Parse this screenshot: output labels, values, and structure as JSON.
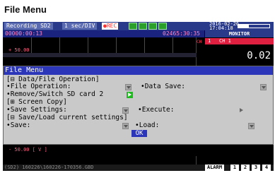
{
  "page_title": "File Menu",
  "topbar": {
    "mode": "Recording SD2",
    "speed": "1 sec/DIV",
    "rec": "●REC",
    "date": "2016-02-26",
    "time": "17:04:18",
    "battery_level": 0.35
  },
  "timebar": {
    "elapsed": "00000:00:13",
    "total": "02465:30:35"
  },
  "monitor": {
    "title": "MONITOR",
    "channel_num": "1",
    "channel_name": "CH 1",
    "value": "0.02",
    "ch_tag": "CH"
  },
  "graph": {
    "upper_value": "+ 50.00",
    "lower_value": "- 50.00 [ V ]"
  },
  "menu": {
    "title": "File Menu",
    "section_data_file": "[⊟ Data/File Operation]",
    "file_operation_label": "•File Operation:",
    "data_save_label": "•Data Save:",
    "remove_sd_label": "•Remove/Switch SD card 2",
    "section_screen_copy": "[⊞ Screen Copy]",
    "save_settings_label": "•Save Settings:",
    "execute_label": "•Execute:",
    "section_save_load": "[⊟ Save/Load current settings]",
    "save_label": "•Save:",
    "load_label": "•Load:",
    "ok_label": "OK"
  },
  "status": {
    "file": "(SD2) 160226\\160226-170356.GBD",
    "alarm": "ALARM",
    "cells": [
      "1",
      "2",
      "3",
      "4"
    ]
  },
  "colors": {
    "menu_title_bg": "#2b37b8",
    "menu_bg": "#c9c9c9",
    "accent_green": "#1dbb1d",
    "rec_red": "#ff3030"
  }
}
